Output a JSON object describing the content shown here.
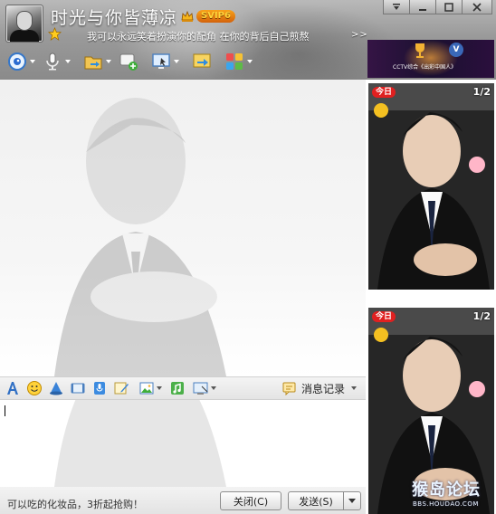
{
  "header": {
    "nickname": "时光与你皆薄凉",
    "vip_label": "SVIP6",
    "signature": "我可以永远笑着扮演你的配角  在你的背后自己煎熬",
    "more_label": ">>",
    "window_buttons": [
      "menu-icon",
      "minimize-icon",
      "maximize-icon",
      "close-icon"
    ]
  },
  "toolbar": {
    "items": [
      "video-call-icon",
      "voice-call-icon",
      "file-transfer-icon",
      "create-group-icon",
      "remote-desktop-icon",
      "screen-share-icon",
      "app-grid-icon"
    ]
  },
  "ad": {
    "text": "CCTV综合《出彩中国人》",
    "logo_letter": "V"
  },
  "side_panel": {
    "cards": [
      {
        "page": "1/2",
        "tag": "今日"
      },
      {
        "page": "1/2",
        "tag": "今日"
      }
    ]
  },
  "input_toolbar": {
    "icons": [
      "font-icon",
      "emoji-icon",
      "shake-icon",
      "magic-expression-icon",
      "voice-message-icon",
      "sticky-note-icon",
      "image-icon",
      "music-icon",
      "screenshot-icon"
    ],
    "history_label": "消息记录"
  },
  "bottom_bar": {
    "promo_text": "可以吃的化妆品，3折起抢购！",
    "close_label": "关闭(C)",
    "send_label": "发送(S)"
  },
  "watermark": {
    "forum_name": "猴岛论坛",
    "forum_url": "BBS.HOUDAO.COM"
  },
  "colors": {
    "vip_gold": "#ffd43a",
    "card_tag_red": "#e02020",
    "ad_background": "#351445"
  }
}
